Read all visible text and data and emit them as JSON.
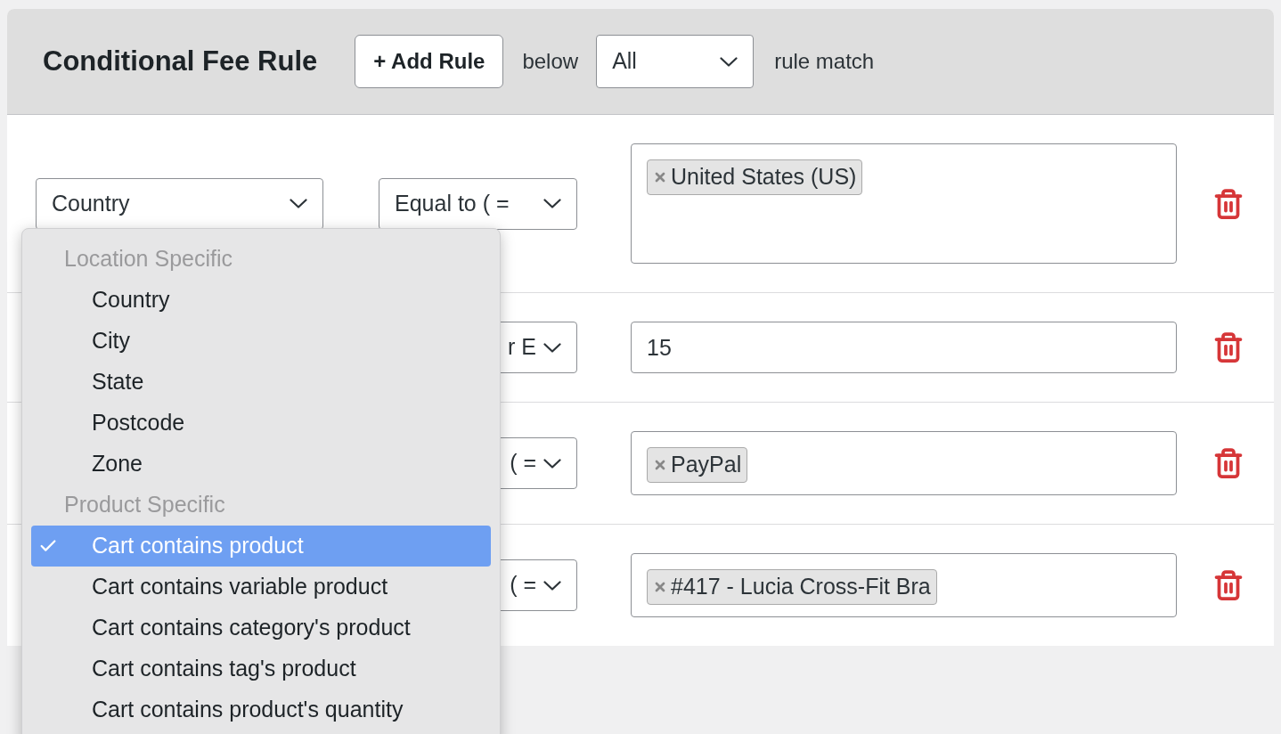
{
  "header": {
    "title": "Conditional Fee Rule",
    "add_button": "+ Add Rule",
    "below_label": "below",
    "match_select": {
      "value": "All"
    },
    "match_label": "rule match"
  },
  "rules": [
    {
      "field": "Country",
      "operator": "Equal to ( =",
      "kind": "tags",
      "tags": [
        "United States (US)"
      ]
    },
    {
      "operator": "r E",
      "kind": "text",
      "value": "15"
    },
    {
      "operator": "( =",
      "kind": "tags",
      "tags": [
        "PayPal"
      ]
    },
    {
      "operator": "( =",
      "kind": "tags",
      "tags": [
        "#417 - Lucia Cross-Fit Bra"
      ]
    }
  ],
  "dropdown": {
    "groups": [
      {
        "label": "Location Specific",
        "options": [
          {
            "label": "Country",
            "selected": false
          },
          {
            "label": "City",
            "selected": false
          },
          {
            "label": "State",
            "selected": false
          },
          {
            "label": "Postcode",
            "selected": false
          },
          {
            "label": "Zone",
            "selected": false
          }
        ]
      },
      {
        "label": "Product Specific",
        "options": [
          {
            "label": "Cart contains product",
            "selected": true
          },
          {
            "label": "Cart contains variable product",
            "selected": false
          },
          {
            "label": "Cart contains category's product",
            "selected": false
          },
          {
            "label": "Cart contains tag's product",
            "selected": false
          },
          {
            "label": "Cart contains product's quantity",
            "selected": false
          }
        ]
      }
    ]
  }
}
